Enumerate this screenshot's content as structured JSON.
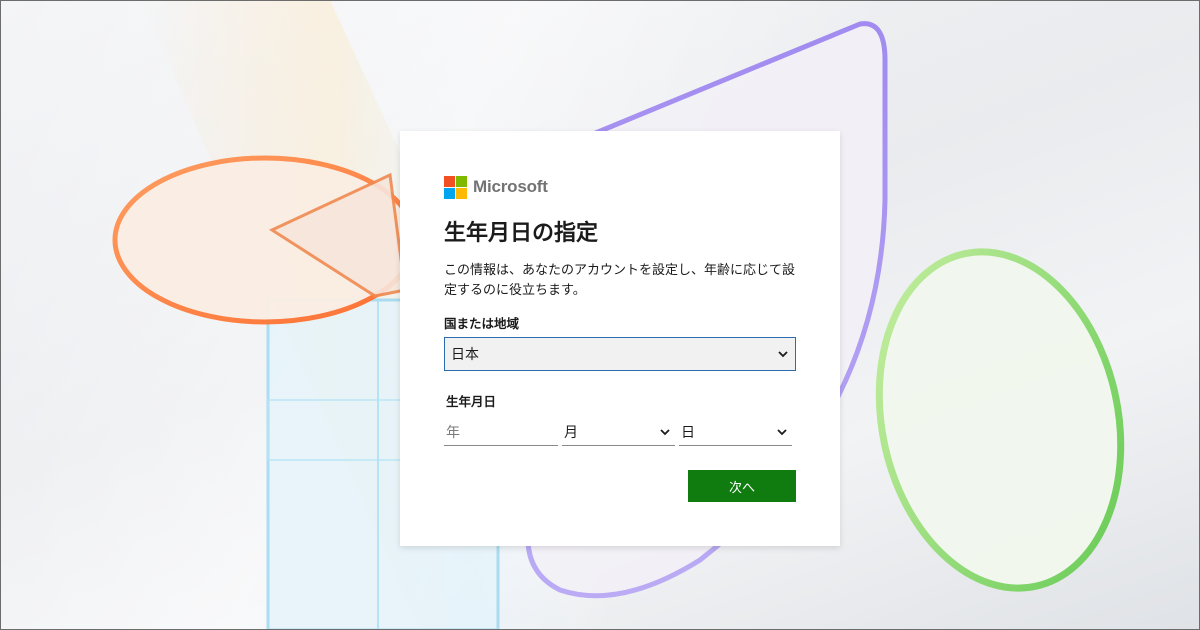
{
  "brand": {
    "name": "Microsoft",
    "colors": [
      "#f25022",
      "#7fba00",
      "#00a4ef",
      "#ffb900"
    ]
  },
  "dialog": {
    "title": "生年月日の指定",
    "description": "この情報は、あなたのアカウントを設定し、年齢に応じて設定するのに役立ちます。",
    "country": {
      "label": "国または地域",
      "selected": "日本"
    },
    "birthdate": {
      "label": "生年月日",
      "year_placeholder": "年",
      "month_value": "月",
      "day_value": "日"
    },
    "next_label": "次へ"
  },
  "colors": {
    "accent": "#107c10",
    "focus_border": "#2b6cb0"
  }
}
